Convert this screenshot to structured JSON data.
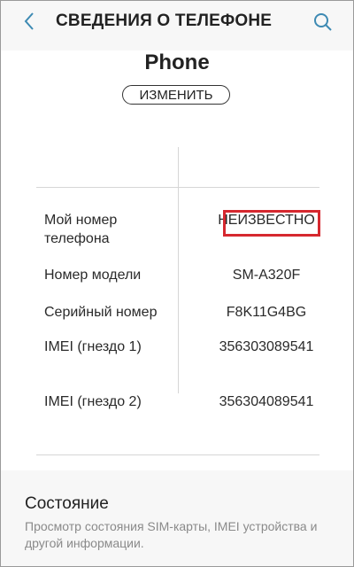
{
  "header": {
    "title": "СВЕДЕНИЯ О ТЕЛЕФОНЕ",
    "back_icon": "chevron-left-icon",
    "search_icon": "search-icon",
    "accent_color": "#3d8ab3"
  },
  "device": {
    "name": "Phone",
    "edit_label": "ИЗМЕНИТЬ"
  },
  "info_rows": [
    {
      "label": "Мой номер телефона",
      "value": "НЕИЗВЕСТНО"
    },
    {
      "label": "Номер модели",
      "value": "SM-A320F"
    },
    {
      "label": "Серийный номер",
      "value": "F8K11G4BG"
    },
    {
      "label": "IMEI (гнездо 1)",
      "value": "356303089541"
    },
    {
      "label": "IMEI (гнездо 2)",
      "value": "356304089541"
    }
  ],
  "highlight_color": "#d6282f",
  "status_section": {
    "title": "Состояние",
    "description": "Просмотр состояния SIM-карты, IMEI устройства и другой информации."
  }
}
